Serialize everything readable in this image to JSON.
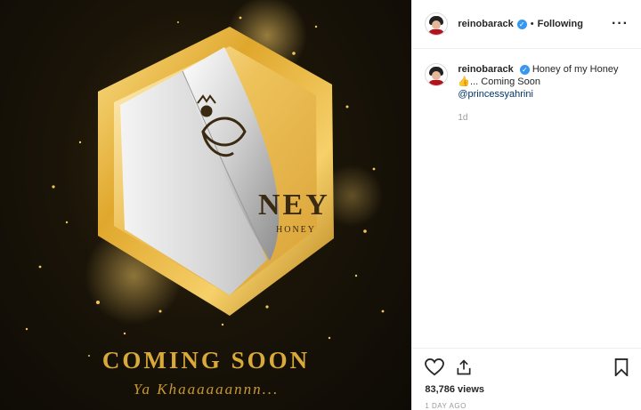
{
  "post_image": {
    "brand_letters": "NEY",
    "brand_subtext": "HONEY",
    "coming_soon": "COMING SOON",
    "tagline": "Ya Khaaaaaannn..."
  },
  "header": {
    "username": "reinobarack",
    "separator": "•",
    "follow_status": "Following",
    "more_icon": "more-horizontal-icon"
  },
  "caption": {
    "username": "reinobarack",
    "line1": "Honey of my Honey",
    "line2": "👍... Coming Soon",
    "mention": "@princessyahrini",
    "age": "1d"
  },
  "actions": {
    "like_icon": "heart-icon",
    "share_icon": "share-icon",
    "save_icon": "bookmark-icon",
    "views": "83,786 views",
    "posted": "1 DAY AGO"
  },
  "colors": {
    "gold": "#d9a93a",
    "verified": "#3897f0",
    "mention": "#003569"
  }
}
